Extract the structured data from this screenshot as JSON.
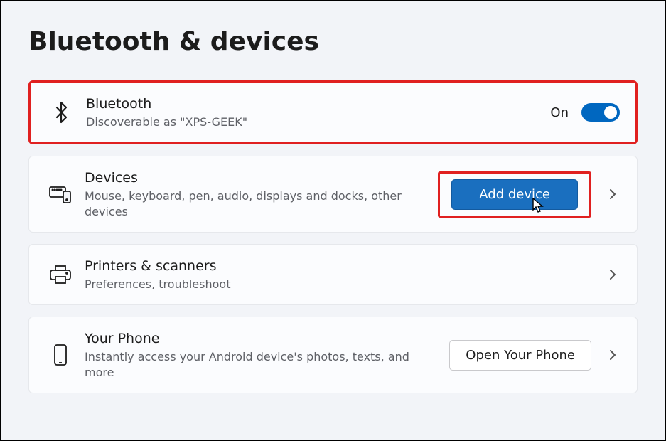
{
  "page": {
    "title": "Bluetooth & devices"
  },
  "bluetooth": {
    "title": "Bluetooth",
    "subtitle": "Discoverable as \"XPS-GEEK\"",
    "state_label": "On",
    "enabled": true
  },
  "devices": {
    "title": "Devices",
    "subtitle": "Mouse, keyboard, pen, audio, displays and docks, other devices",
    "button_label": "Add device"
  },
  "printers": {
    "title": "Printers & scanners",
    "subtitle": "Preferences, troubleshoot"
  },
  "phone": {
    "title": "Your Phone",
    "subtitle": "Instantly access your Android device's photos, texts, and more",
    "button_label": "Open Your Phone"
  },
  "colors": {
    "accent": "#0067c0",
    "highlight": "#e02020"
  }
}
